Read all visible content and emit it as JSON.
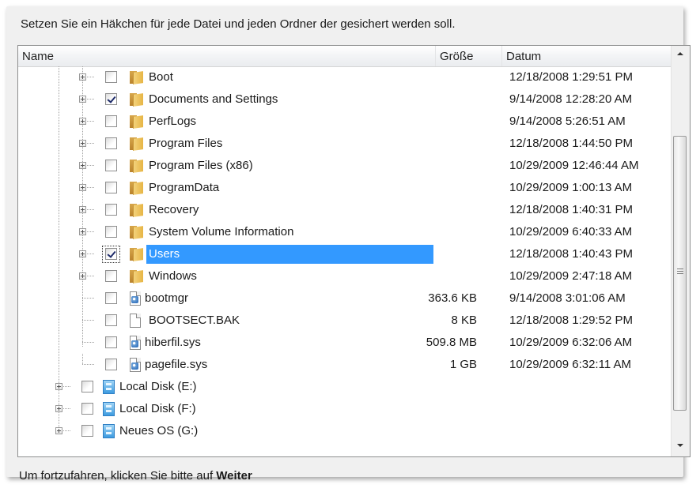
{
  "instruction": "Setzen Sie ein Häkchen für jede Datei und jeden Ordner der gesichert werden soll.",
  "columns": {
    "name": "Name",
    "size": "Größe",
    "date": "Datum"
  },
  "rows": [
    {
      "name": "Boot",
      "size": "",
      "date": "12/18/2008 1:29:51 PM",
      "type": "folder",
      "checked": false
    },
    {
      "name": "Documents and Settings",
      "size": "",
      "date": "9/14/2008 12:28:20 AM",
      "type": "folder",
      "checked": true
    },
    {
      "name": "PerfLogs",
      "size": "",
      "date": "9/14/2008 5:26:51 AM",
      "type": "folder",
      "checked": false
    },
    {
      "name": "Program Files",
      "size": "",
      "date": "12/18/2008 1:44:50 PM",
      "type": "folder",
      "checked": false
    },
    {
      "name": "Program Files (x86)",
      "size": "",
      "date": "10/29/2009 12:46:44 AM",
      "type": "folder",
      "checked": false
    },
    {
      "name": "ProgramData",
      "size": "",
      "date": "10/29/2009 1:00:13 AM",
      "type": "folder",
      "checked": false
    },
    {
      "name": "Recovery",
      "size": "",
      "date": "12/18/2008 1:40:31 PM",
      "type": "folder",
      "checked": false
    },
    {
      "name": "System Volume Information",
      "size": "",
      "date": "10/29/2009 6:40:33 AM",
      "type": "folder",
      "checked": false
    },
    {
      "name": "Users",
      "size": "",
      "date": "12/18/2008 1:40:43 PM",
      "type": "folder",
      "checked": true,
      "selected": true
    },
    {
      "name": "Windows",
      "size": "",
      "date": "10/29/2009 2:47:18 AM",
      "type": "folder",
      "checked": false
    },
    {
      "name": "bootmgr",
      "size": "363.6 KB",
      "date": "9/14/2008 3:01:06 AM",
      "type": "sysfile",
      "checked": false
    },
    {
      "name": "BOOTSECT.BAK",
      "size": "8 KB",
      "date": "12/18/2008 1:29:52 PM",
      "type": "file",
      "checked": false
    },
    {
      "name": "hiberfil.sys",
      "size": "509.8 MB",
      "date": "10/29/2009 6:32:06 AM",
      "type": "sysfile",
      "checked": false
    },
    {
      "name": "pagefile.sys",
      "size": "1 GB",
      "date": "10/29/2009 6:32:11 AM",
      "type": "sysfile",
      "checked": false
    },
    {
      "name": "Local Disk (E:)",
      "size": "",
      "date": "",
      "type": "disk",
      "checked": false
    },
    {
      "name": "Local Disk (F:)",
      "size": "",
      "date": "",
      "type": "disk",
      "checked": false
    },
    {
      "name": "Neues OS (G:)",
      "size": "",
      "date": "",
      "type": "disk",
      "checked": false
    }
  ],
  "footer": {
    "prefix": "Um fortzufahren, klicken Sie bitte auf ",
    "action": "Weiter"
  },
  "colors": {
    "selection": "#3399ff",
    "panel": "#f0f0f0"
  },
  "icons": {
    "expander": "plus-box-icon",
    "folder": "folder-icon",
    "file": "file-icon",
    "disk": "drive-icon"
  }
}
